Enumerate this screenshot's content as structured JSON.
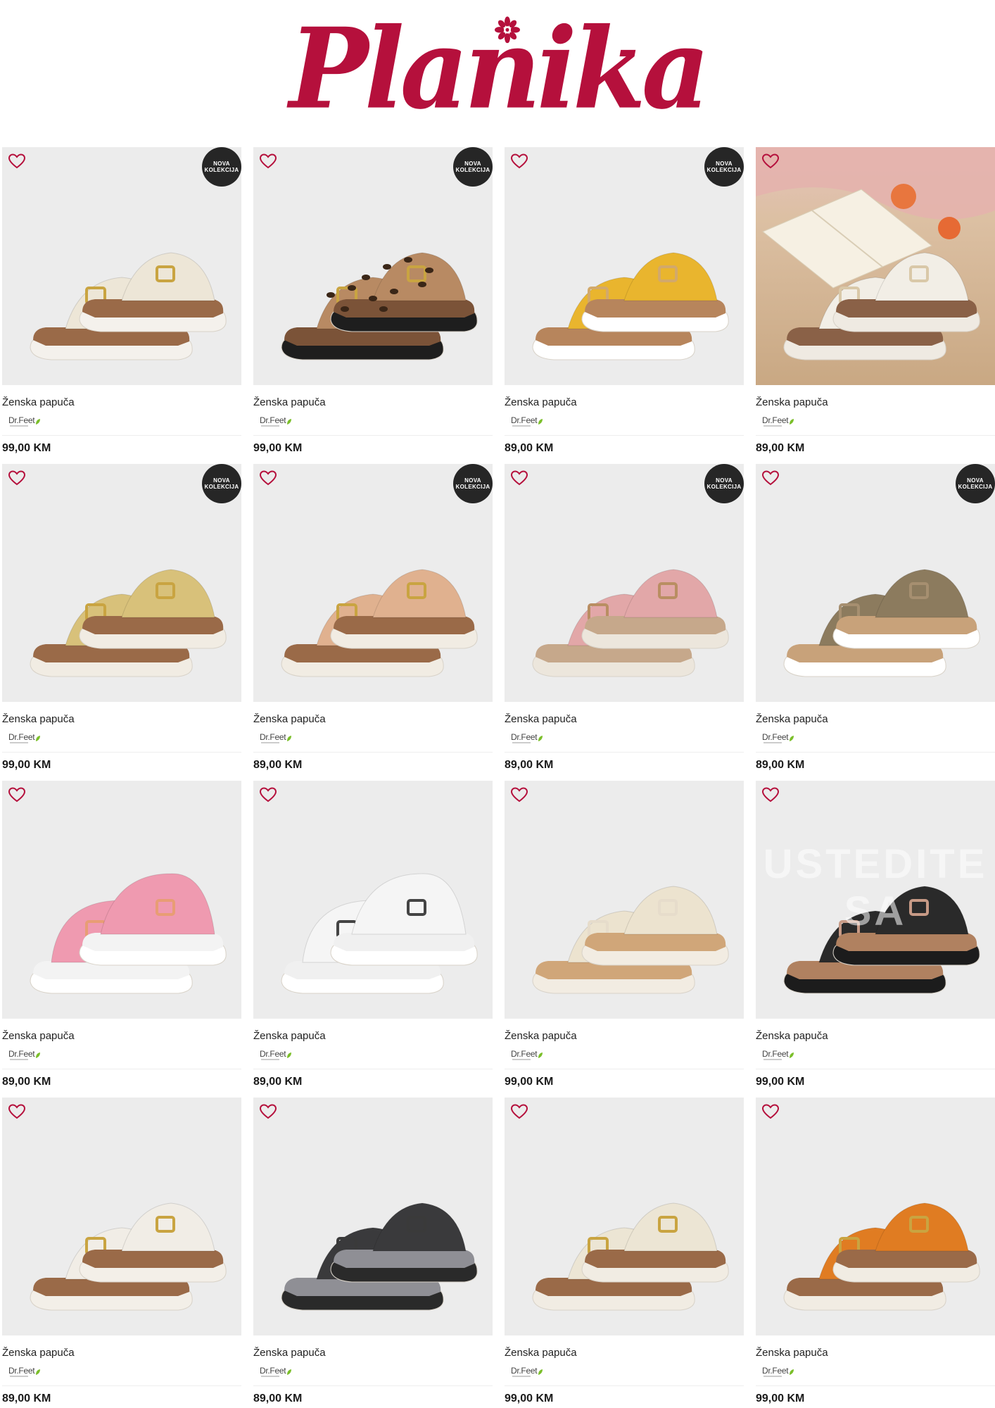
{
  "brand": {
    "logo_text": "Planika",
    "logo_color": "#b5103c"
  },
  "badge_lines": [
    "NOVA",
    "KOLEKCIJA"
  ],
  "products": [
    {
      "name": "Ženska papuča",
      "brand": "Dr.Feet",
      "price": "99,00 KM",
      "badge": true,
      "style": {
        "upper": "#ede6d7",
        "sole": "#9a6a48",
        "base": "#f4f1ec",
        "buckle": "#c9a441"
      }
    },
    {
      "name": "Ženska papuča",
      "brand": "Dr.Feet",
      "price": "99,00 KM",
      "badge": true,
      "style": {
        "upper": "#b88a63",
        "sole": "#7b5338",
        "base": "#1e1e1e",
        "buckle": "#c9a441",
        "pattern": "leopard"
      }
    },
    {
      "name": "Ženska papuča",
      "brand": "Dr.Feet",
      "price": "89,00 KM",
      "badge": true,
      "style": {
        "upper": "#e9b52e",
        "sole": "#b7855c",
        "base": "#ffffff",
        "buckle": "#d2a96b"
      }
    },
    {
      "name": "Ženska papuča",
      "brand": "Dr.Feet",
      "price": "89,00 KM",
      "badge": false,
      "lifestyle": true,
      "style": {
        "upper": "#f2eee6",
        "sole": "#8a6147",
        "base": "#efeae2",
        "buckle": "#d9c8a8"
      }
    },
    {
      "name": "Ženska papuča",
      "brand": "Dr.Feet",
      "price": "99,00 KM",
      "badge": true,
      "style": {
        "upper": "#d8c17a",
        "sole": "#9a6a48",
        "base": "#f1ece3",
        "buckle": "#c9a441"
      }
    },
    {
      "name": "Ženska papuča",
      "brand": "Dr.Feet",
      "price": "89,00 KM",
      "badge": true,
      "style": {
        "upper": "#e0b18f",
        "sole": "#9a6a48",
        "base": "#f1ece3",
        "buckle": "#c9a441"
      }
    },
    {
      "name": "Ženska papuča",
      "brand": "Dr.Feet",
      "price": "89,00 KM",
      "badge": true,
      "style": {
        "upper": "#e2a7a8",
        "sole": "#c6a88b",
        "base": "#ece6dc",
        "buckle": "#b98e62"
      }
    },
    {
      "name": "Ženska papuča",
      "brand": "Dr.Feet",
      "price": "89,00 KM",
      "badge": true,
      "style": {
        "upper": "#8c7b5e",
        "sole": "#c8a27a",
        "base": "#ffffff",
        "buckle": "#a68f70"
      }
    },
    {
      "name": "Ženska papuča",
      "brand": "Dr.Feet",
      "price": "89,00 KM",
      "badge": false,
      "style": {
        "upper": "#ef9ab0",
        "sole": "#f3f3f3",
        "base": "#ffffff",
        "buckle": "#e89d74",
        "clog": true
      }
    },
    {
      "name": "Ženska papuča",
      "brand": "Dr.Feet",
      "price": "89,00 KM",
      "badge": false,
      "style": {
        "upper": "#f5f5f5",
        "sole": "#f0f0f0",
        "base": "#ffffff",
        "buckle": "#444444",
        "clog": true
      }
    },
    {
      "name": "Ženska papuča",
      "brand": "Dr.Feet",
      "price": "99,00 KM",
      "badge": false,
      "style": {
        "upper": "#ece3cf",
        "sole": "#d0a679",
        "base": "#f2ece2",
        "buckle": "#e6dccb"
      }
    },
    {
      "name": "Ženska papuča",
      "brand": "Dr.Feet",
      "price": "99,00 KM",
      "badge": false,
      "style": {
        "upper": "#2a2a2a",
        "sole": "#b08160",
        "base": "#1c1c1c",
        "buckle": "#c79a86"
      },
      "watermark": "USTEDITE SA"
    },
    {
      "name": "Ženska papuča",
      "brand": "Dr.Feet",
      "price": "89,00 KM",
      "badge": false,
      "style": {
        "upper": "#f1ede6",
        "sole": "#9a6a48",
        "base": "#f3efe8",
        "buckle": "#c9a441"
      }
    },
    {
      "name": "Ženska papuča",
      "brand": "Dr.Feet",
      "price": "89,00 KM",
      "badge": false,
      "style": {
        "upper": "#3a3a3c",
        "sole": "#8f8f95",
        "base": "#2a2a2a",
        "buckle": "#3a3a3a"
      }
    },
    {
      "name": "Ženska papuča",
      "brand": "Dr.Feet",
      "price": "99,00 KM",
      "badge": false,
      "style": {
        "upper": "#ece5d4",
        "sole": "#9a6a48",
        "base": "#f1ece3",
        "buckle": "#c9a441"
      }
    },
    {
      "name": "Ženska papuča",
      "brand": "Dr.Feet",
      "price": "99,00 KM",
      "badge": false,
      "style": {
        "upper": "#e07c22",
        "sole": "#9a6a48",
        "base": "#f1ece3",
        "buckle": "#c9a441"
      }
    }
  ]
}
